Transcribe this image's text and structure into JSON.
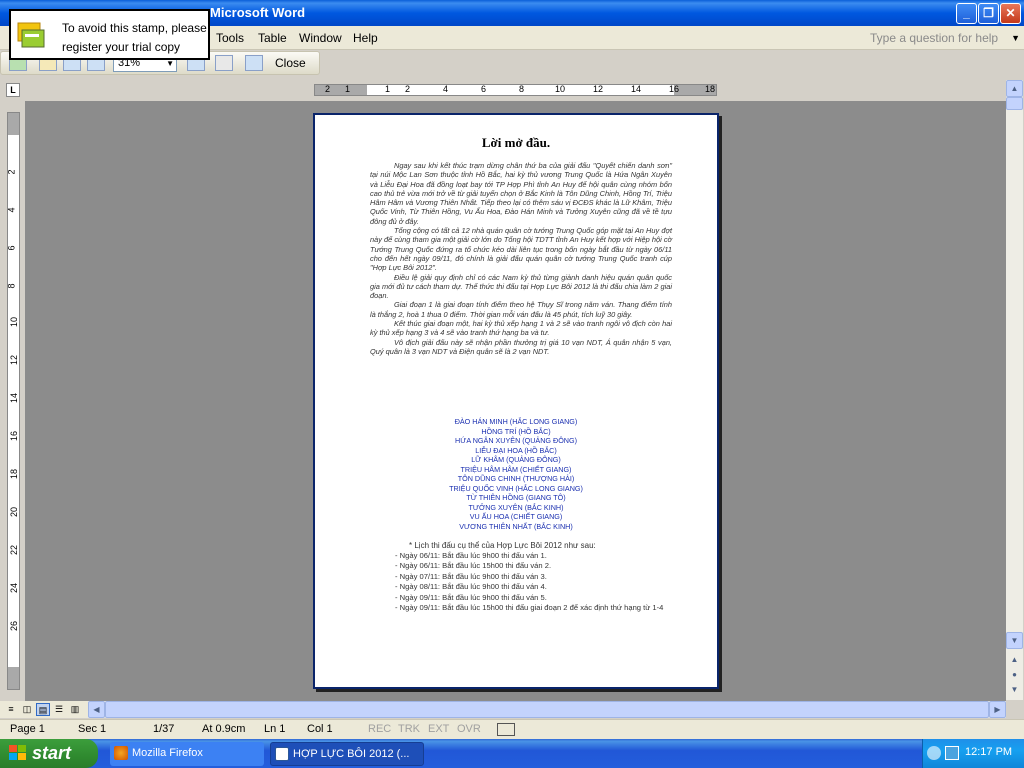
{
  "window": {
    "title": "Microsoft Word",
    "min_label": "_",
    "max_label": "❐",
    "close_label": "✕"
  },
  "menu": {
    "items": [
      "Tools",
      "Table",
      "Window",
      "Help"
    ],
    "ask_placeholder": "Type a question for help"
  },
  "toolbar": {
    "zoom": "31%",
    "close_label": "Close"
  },
  "stamp": {
    "line1": "To avoid this stamp, please",
    "line2": "register your trial copy"
  },
  "ruler": {
    "corner": "L",
    "h_numbers": [
      "2",
      "1",
      "1",
      "2",
      "4",
      "6",
      "8",
      "10",
      "12",
      "14",
      "16",
      "18"
    ],
    "v_numbers": [
      "2",
      "4",
      "6",
      "8",
      "10",
      "12",
      "14",
      "16",
      "18",
      "20",
      "22",
      "24",
      "26"
    ]
  },
  "document": {
    "title": "Lời mở đầu.",
    "paragraphs": [
      "Ngay sau khi kết thúc trạm dừng chân thứ ba của giải đấu \"Quyết chiến danh sơn\" tại núi Mộc Lan Sơn thuộc tỉnh Hồ Bắc, hai kỳ thủ vương Trung Quốc là Hứa Ngân Xuyên và Liễu Đại Hoa đã đồng loạt bay tới TP Hợp Phì tỉnh An Huy để hội quân cùng nhóm bốn cao thủ trẻ vừa mới trở về từ giải tuyển chọn ở Bắc Kinh là Tôn Dũng Chinh, Hồng Trí, Triệu Hâm Hâm và Vương Thiên Nhất. Tiếp theo lại có thêm sáu vị ĐCĐS khác là Lữ Khâm, Triệu Quốc Vinh, Từ Thiên Hồng, Vu Ấu Hoa, Đào Hán Minh và Tưởng Xuyên cũng đã về tề tựu đông đủ ở đây.",
      "Tổng cộng có tất cả 12 nhà quán quân cờ tướng Trung Quốc góp mặt tại An Huy đợt này để cùng tham gia một giải cờ lớn do Tổng hội TDTT tỉnh An Huy kết hợp với Hiệp hội cờ Tướng Trung Quốc đứng ra tổ chức kéo dài liên tục trong bốn ngày bắt đầu từ ngày 06/11 cho đến hết ngày 09/11, đó chính là giải đấu quán quân cờ tướng Trung Quốc tranh cúp \"Hợp Lực Bôi 2012\".",
      "Điều lệ giải quy định chỉ có các Nam kỳ thủ từng giành danh hiệu quán quân quốc gia mới đủ tư cách tham dự. Thể thức thi đấu tại Hợp Lực Bôi 2012 là thi đấu chia làm 2 giai đoạn.",
      "Giai đoạn 1 là giai đoạn tính điểm theo hệ Thụy Sĩ trong năm ván. Thang điểm tính là thắng 2, hoà 1 thua 0 điểm. Thời gian mỗi ván đấu là 45 phút, tích luỹ 30 giây.",
      "Kết thúc giai đoạn một, hai kỳ thủ xếp hạng 1 và 2 sẽ vào tranh ngôi vô địch còn hai kỳ thủ xếp hạng 3 và 4 sẽ vào tranh thứ hạng ba và tư.",
      "Vô địch giải đấu này sẽ nhận phần thưởng trị giá 10 vạn NDT, Á quân nhận 5 vạn, Quý quân là 3 vạn NDT và Điện quân sẽ là 2 vạn NDT."
    ],
    "players": [
      "ĐÀO HÁN MINH (HẮC LONG GIANG)",
      "HỒNG TRÍ (HỒ BẮC)",
      "HỨA NGÂN XUYÊN (QUẢNG ĐÔNG)",
      "LIỄU ĐẠI HOA (HỒ BẮC)",
      "LỮ KHÂM (QUẢNG ĐÔNG)",
      "TRIỆU HÂM HÂM (CHIẾT GIANG)",
      "TÔN DŨNG CHINH (THƯỢNG HẢI)",
      "TRIỆU QUỐC VINH (HẮC LONG GIANG)",
      "TỪ THIÊN HỒNG (GIANG TÔ)",
      "TƯỞNG XUYÊN (BẮC KINH)",
      "VU ẤU HOA (CHIẾT GIANG)",
      "VƯƠNG THIÊN NHẤT (BẮC KINH)"
    ],
    "schedule_title": "* Lịch thi đấu cụ thể của Hợp Lực Bôi 2012 như sau:",
    "schedule": [
      "- Ngày 06/11: Bắt đầu lúc 9h00 thi đấu ván 1.",
      "- Ngày 06/11: Bắt đầu lúc 15h00 thi đấu ván 2.",
      "- Ngày 07/11: Bắt đầu lúc 9h00 thi đấu ván 3.",
      "- Ngày 08/11: Bắt đầu lúc 9h00 thi đấu ván 4.",
      "- Ngày 09/11: Bắt đầu lúc 9h00 thi đấu ván 5.",
      "- Ngày 09/11: Bắt đầu lúc 15h00 thi đấu giai đoạn 2 để xác định thứ hạng từ 1-4"
    ]
  },
  "status": {
    "page": "Page 1",
    "sec": "Sec 1",
    "pages": "1/37",
    "at": "At 0.9cm",
    "ln": "Ln 1",
    "col": "Col 1",
    "rec": "REC",
    "trk": "TRK",
    "ext": "EXT",
    "ovr": "OVR"
  },
  "taskbar": {
    "start": "start",
    "tasks": [
      "Mozilla Firefox",
      "HỢP LỰC BÔI 2012 (..."
    ],
    "time": "12:17 PM"
  }
}
